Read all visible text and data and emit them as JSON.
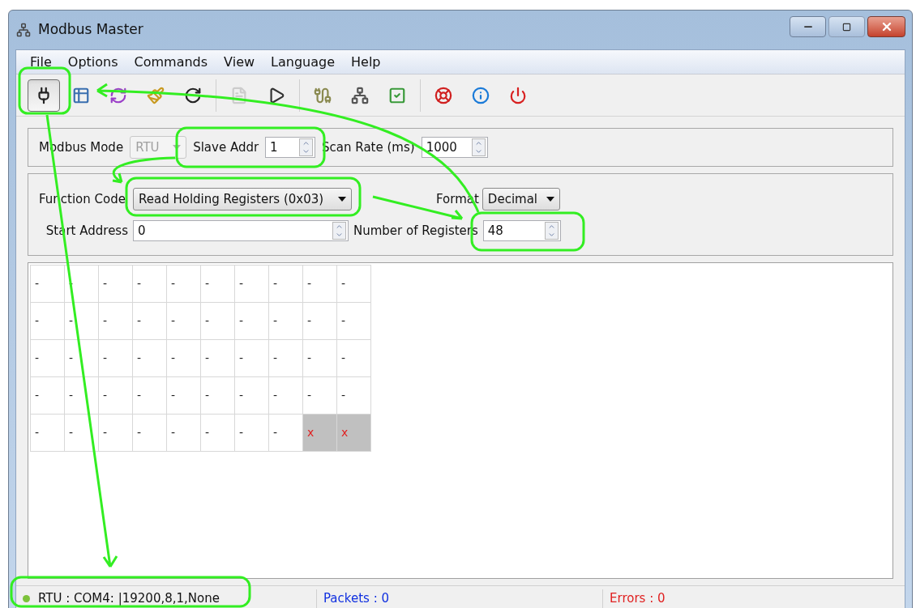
{
  "window": {
    "title": "Modbus Master"
  },
  "menu": [
    {
      "label": "File"
    },
    {
      "label": "Options"
    },
    {
      "label": "Commands"
    },
    {
      "label": "View"
    },
    {
      "label": "Language"
    },
    {
      "label": "Help"
    }
  ],
  "toolbar": [
    [
      {
        "kind": "connect",
        "pressed": true,
        "disabled": false
      },
      {
        "kind": "table",
        "pressed": false,
        "disabled": false
      },
      {
        "kind": "cycle",
        "pressed": false,
        "disabled": false
      },
      {
        "kind": "broom",
        "pressed": false,
        "disabled": false
      },
      {
        "kind": "reload",
        "pressed": false,
        "disabled": false
      }
    ],
    [
      {
        "kind": "log",
        "pressed": false,
        "disabled": true
      },
      {
        "kind": "play",
        "pressed": false,
        "disabled": false
      }
    ],
    [
      {
        "kind": "serial",
        "pressed": false,
        "disabled": false
      },
      {
        "kind": "network",
        "pressed": false,
        "disabled": false
      },
      {
        "kind": "check",
        "pressed": false,
        "disabled": false
      }
    ],
    [
      {
        "kind": "help",
        "pressed": false,
        "disabled": false
      },
      {
        "kind": "info",
        "pressed": false,
        "disabled": false
      },
      {
        "kind": "power",
        "pressed": false,
        "disabled": false
      }
    ]
  ],
  "connection": {
    "mode_label": "Modbus Mode",
    "mode": "RTU",
    "mode_disabled": true,
    "slave_label": "Slave Addr",
    "slave": "1",
    "scan_label": "Scan Rate (ms)",
    "scan": "1000"
  },
  "request": {
    "function_label": "Function Code",
    "function": "Read Holding Registers (0x03)",
    "format_label": "Format",
    "format": "Decimal",
    "start_label": "Start Address",
    "start": "0",
    "count_label": "Number of Registers",
    "count": "48"
  },
  "registers": [
    [
      {
        "value": "-",
        "error": false
      },
      {
        "value": "-",
        "error": false
      },
      {
        "value": "-",
        "error": false
      },
      {
        "value": "-",
        "error": false
      },
      {
        "value": "-",
        "error": false
      },
      {
        "value": "-",
        "error": false
      },
      {
        "value": "-",
        "error": false
      },
      {
        "value": "-",
        "error": false
      },
      {
        "value": "-",
        "error": false
      },
      {
        "value": "-",
        "error": false
      }
    ],
    [
      {
        "value": "-",
        "error": false
      },
      {
        "value": "-",
        "error": false
      },
      {
        "value": "-",
        "error": false
      },
      {
        "value": "-",
        "error": false
      },
      {
        "value": "-",
        "error": false
      },
      {
        "value": "-",
        "error": false
      },
      {
        "value": "-",
        "error": false
      },
      {
        "value": "-",
        "error": false
      },
      {
        "value": "-",
        "error": false
      },
      {
        "value": "-",
        "error": false
      }
    ],
    [
      {
        "value": "-",
        "error": false
      },
      {
        "value": "-",
        "error": false
      },
      {
        "value": "-",
        "error": false
      },
      {
        "value": "-",
        "error": false
      },
      {
        "value": "-",
        "error": false
      },
      {
        "value": "-",
        "error": false
      },
      {
        "value": "-",
        "error": false
      },
      {
        "value": "-",
        "error": false
      },
      {
        "value": "-",
        "error": false
      },
      {
        "value": "-",
        "error": false
      }
    ],
    [
      {
        "value": "-",
        "error": false
      },
      {
        "value": "-",
        "error": false
      },
      {
        "value": "-",
        "error": false
      },
      {
        "value": "-",
        "error": false
      },
      {
        "value": "-",
        "error": false
      },
      {
        "value": "-",
        "error": false
      },
      {
        "value": "-",
        "error": false
      },
      {
        "value": "-",
        "error": false
      },
      {
        "value": "-",
        "error": false
      },
      {
        "value": "-",
        "error": false
      }
    ],
    [
      {
        "value": "-",
        "error": false
      },
      {
        "value": "-",
        "error": false
      },
      {
        "value": "-",
        "error": false
      },
      {
        "value": "-",
        "error": false
      },
      {
        "value": "-",
        "error": false
      },
      {
        "value": "-",
        "error": false
      },
      {
        "value": "-",
        "error": false
      },
      {
        "value": "-",
        "error": false
      },
      {
        "value": "x",
        "error": true
      },
      {
        "value": "x",
        "error": true
      }
    ]
  ],
  "status_bar": {
    "connected": true,
    "connection": "RTU : COM4: |19200,8,1,None",
    "packets": "Packets : 0",
    "errors": "Errors : 0"
  }
}
